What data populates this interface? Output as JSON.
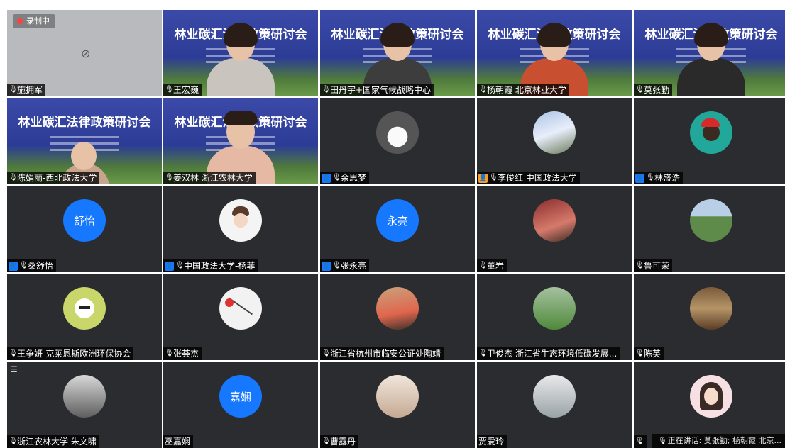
{
  "recording": {
    "label": "录制中"
  },
  "banner_title": "林业碳汇法律政策研讨会",
  "speaking": {
    "text": "正在讲话: 莫张勤; 杨朝霞 北京..."
  },
  "tiles": [
    {
      "name": "施拥军",
      "type": "camoff",
      "mic": "normal"
    },
    {
      "name": "王宏巍",
      "type": "video",
      "mic": "normal"
    },
    {
      "name": "田丹宇+国家气候战略中心",
      "type": "video",
      "mic": "active"
    },
    {
      "name": "杨朝霞 北京林业大学",
      "type": "video",
      "mic": "active"
    },
    {
      "name": "莫张勤",
      "type": "video",
      "mic": "active"
    },
    {
      "name": "陈娟丽-西北政法大学",
      "type": "video",
      "mic": "normal"
    },
    {
      "name": "姜双林 浙江农林大学",
      "type": "video",
      "mic": "active"
    },
    {
      "name": "余思梦",
      "type": "avatar",
      "avatar": "husky-icon",
      "user": "blue",
      "mic": "normal"
    },
    {
      "name": "李俊红 中国政法大学",
      "type": "avatar",
      "avatar": "blossom",
      "user": "orange",
      "mic": "normal"
    },
    {
      "name": "林盛浩",
      "type": "avatar",
      "avatar": "santa-icon",
      "user": "blue",
      "mic": "normal"
    },
    {
      "name": "桑舒怡",
      "type": "text-avatar",
      "avatar_text": "舒怡",
      "user": "blue",
      "mic": "normal"
    },
    {
      "name": "中国政法大学-杨菲",
      "type": "avatar",
      "avatar": "cartoon",
      "user": "blue",
      "mic": "normal"
    },
    {
      "name": "张永亮",
      "type": "text-avatar",
      "avatar_text": "永亮",
      "user": "blue",
      "mic": "normal"
    },
    {
      "name": "董岩",
      "type": "avatar",
      "avatar": "speaker",
      "mic": "normal"
    },
    {
      "name": "鲁可荣",
      "type": "avatar",
      "avatar": "land",
      "mic": "normal"
    },
    {
      "name": "王争妍-克莱恩斯欧洲环保协会",
      "type": "avatar",
      "avatar": "bunny",
      "mic": "normal"
    },
    {
      "name": "张荟杰",
      "type": "avatar",
      "avatar": "sketch",
      "mic": "normal"
    },
    {
      "name": "浙江省杭州市临安公证处陶靖",
      "type": "avatar",
      "avatar": "painting",
      "mic": "normal"
    },
    {
      "name": "卫俊杰 浙江省生态环境低碳发展...",
      "type": "avatar",
      "avatar": "golf",
      "mic": "normal"
    },
    {
      "name": "陈英",
      "type": "avatar",
      "avatar": "library",
      "mic": "normal"
    },
    {
      "name": "浙江农林大学 朱文啸",
      "type": "avatar",
      "avatar": "bw",
      "mic": "normal"
    },
    {
      "name": "巫嘉娴",
      "type": "text-avatar",
      "avatar_text": "嘉娴",
      "mic": "none"
    },
    {
      "name": "曹露丹",
      "type": "avatar",
      "avatar": "baby",
      "mic": "normal"
    },
    {
      "name": "贾爱玲",
      "type": "avatar",
      "avatar": "office",
      "mic": "none"
    },
    {
      "name": "",
      "type": "avatar",
      "avatar": "girl",
      "mic": "normal"
    }
  ]
}
